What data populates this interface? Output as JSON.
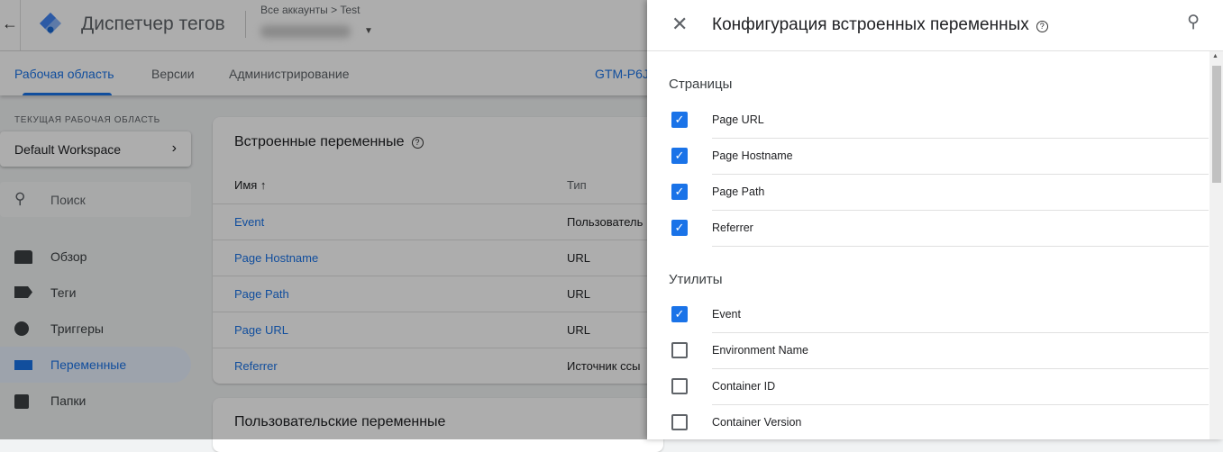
{
  "header": {
    "app_title": "Диспетчер тегов",
    "breadcrumb": "Все аккаунты > Test"
  },
  "nav": {
    "tabs": [
      {
        "label": "Рабочая область",
        "active": true
      },
      {
        "label": "Версии"
      },
      {
        "label": "Администрирование"
      }
    ],
    "container_id": "GTM-P6J"
  },
  "sidebar": {
    "workspace_label": "ТЕКУЩАЯ РАБОЧАЯ ОБЛАСТЬ",
    "workspace": "Default Workspace",
    "search_placeholder": "Поиск",
    "items": [
      {
        "label": "Обзор"
      },
      {
        "label": "Теги"
      },
      {
        "label": "Триггеры"
      },
      {
        "label": "Переменные",
        "selected": true
      },
      {
        "label": "Папки"
      }
    ]
  },
  "builtin_card": {
    "title": "Встроенные переменные",
    "col_name": "Имя ↑",
    "col_type": "Тип",
    "rows": [
      {
        "name": "Event",
        "type": "Пользователь"
      },
      {
        "name": "Page Hostname",
        "type": "URL"
      },
      {
        "name": "Page Path",
        "type": "URL"
      },
      {
        "name": "Page URL",
        "type": "URL"
      },
      {
        "name": "Referrer",
        "type": "Источник ссы"
      }
    ]
  },
  "custom_card": {
    "title": "Пользовательские переменные"
  },
  "panel": {
    "title": "Конфигурация встроенных переменных",
    "sections": [
      {
        "title": "Страницы",
        "items": [
          {
            "label": "Page URL",
            "checked": true
          },
          {
            "label": "Page Hostname",
            "checked": true
          },
          {
            "label": "Page Path",
            "checked": true
          },
          {
            "label": "Referrer",
            "checked": true
          }
        ]
      },
      {
        "title": "Утилиты",
        "items": [
          {
            "label": "Event",
            "checked": true
          },
          {
            "label": "Environment Name",
            "checked": false
          },
          {
            "label": "Container ID",
            "checked": false
          },
          {
            "label": "Container Version",
            "checked": false
          }
        ]
      }
    ]
  },
  "colors": {
    "accent": "#1a73e8"
  }
}
